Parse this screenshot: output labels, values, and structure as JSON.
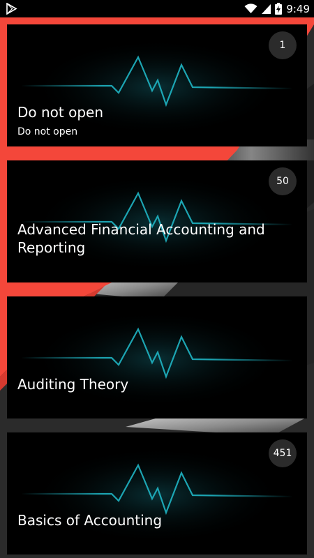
{
  "status_bar": {
    "time": "9:49",
    "icons": [
      "play-store-icon",
      "wifi-icon",
      "cell-signal-icon",
      "battery-charging-icon"
    ]
  },
  "colors": {
    "accent": "#f4473a",
    "card_bg": "#000000",
    "wave": "#1fb5c4",
    "badge_bg": "#2b2b2b"
  },
  "cards": [
    {
      "title": "Do not open",
      "subtitle": "Do not open",
      "count": "1"
    },
    {
      "title": "Advanced Financial Accounting and Reporting",
      "subtitle": "",
      "count": "50"
    },
    {
      "title": "Auditing Theory",
      "subtitle": "",
      "count": ""
    },
    {
      "title": "Basics of Accounting",
      "subtitle": "",
      "count": "451"
    }
  ]
}
